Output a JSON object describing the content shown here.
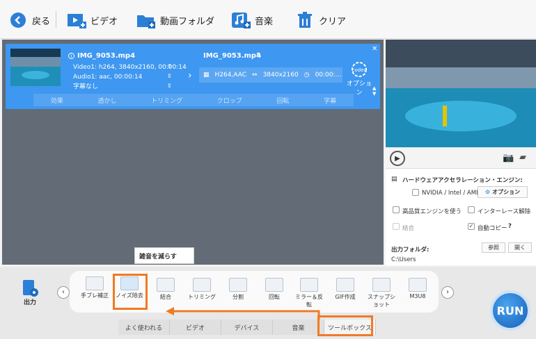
{
  "toolbar": {
    "back_label": "戻る",
    "video_label": "ビデオ",
    "folder_label": "動画フォルダ",
    "music_label": "音楽",
    "clear_label": "クリア"
  },
  "task": {
    "source_name": "IMG_9053.mp4",
    "video_info": "Video1: h264, 3840x2160, 00:00:14",
    "audio_info": "Audio1: aac, 00:00:14",
    "subtitle_info": "字幕なし",
    "output_name": "IMG_9053.mp4",
    "codec": "H264,AAC",
    "resolution": "3840x2160",
    "duration": "00:00:…",
    "codec_badge": "codec",
    "option_label": "オプション",
    "tools": [
      "効果",
      "透かし",
      "トリミング",
      "クロップ",
      "回転",
      "字幕"
    ]
  },
  "settings": {
    "hw_title": "ハードウェアアクセラレーション・エンジン:",
    "nvidia_label": "NVIDIA / Intel / AMD",
    "option_button": "オプション",
    "hq_engine": "高品質エンジンを使う",
    "deinterlace": "インターレース解除",
    "merge": "結合",
    "autocopy": "自動コピー",
    "output_folder_label": "出力フォルダ:",
    "browse": "参照",
    "open": "開く",
    "path": "C:\\Users"
  },
  "bottom": {
    "output_label": "出力",
    "tooltip": "雑音を減らす",
    "tools": [
      {
        "label": "手ブレ補正"
      },
      {
        "label": "ノイズ除去"
      },
      {
        "label": "結合"
      },
      {
        "label": "トリミング"
      },
      {
        "label": "分割"
      },
      {
        "label": "回転"
      },
      {
        "label": "ミラー＆反転"
      },
      {
        "label": "GIF作成"
      },
      {
        "label": "スナップショット"
      },
      {
        "label": "M3U8"
      }
    ],
    "tabs": [
      "よく使われる",
      "ビデオ",
      "デバイス",
      "音楽",
      "ツールボックス"
    ],
    "run_label": "RUN"
  },
  "colors": {
    "accent": "#3e97f0",
    "highlight": "#f07a23"
  }
}
